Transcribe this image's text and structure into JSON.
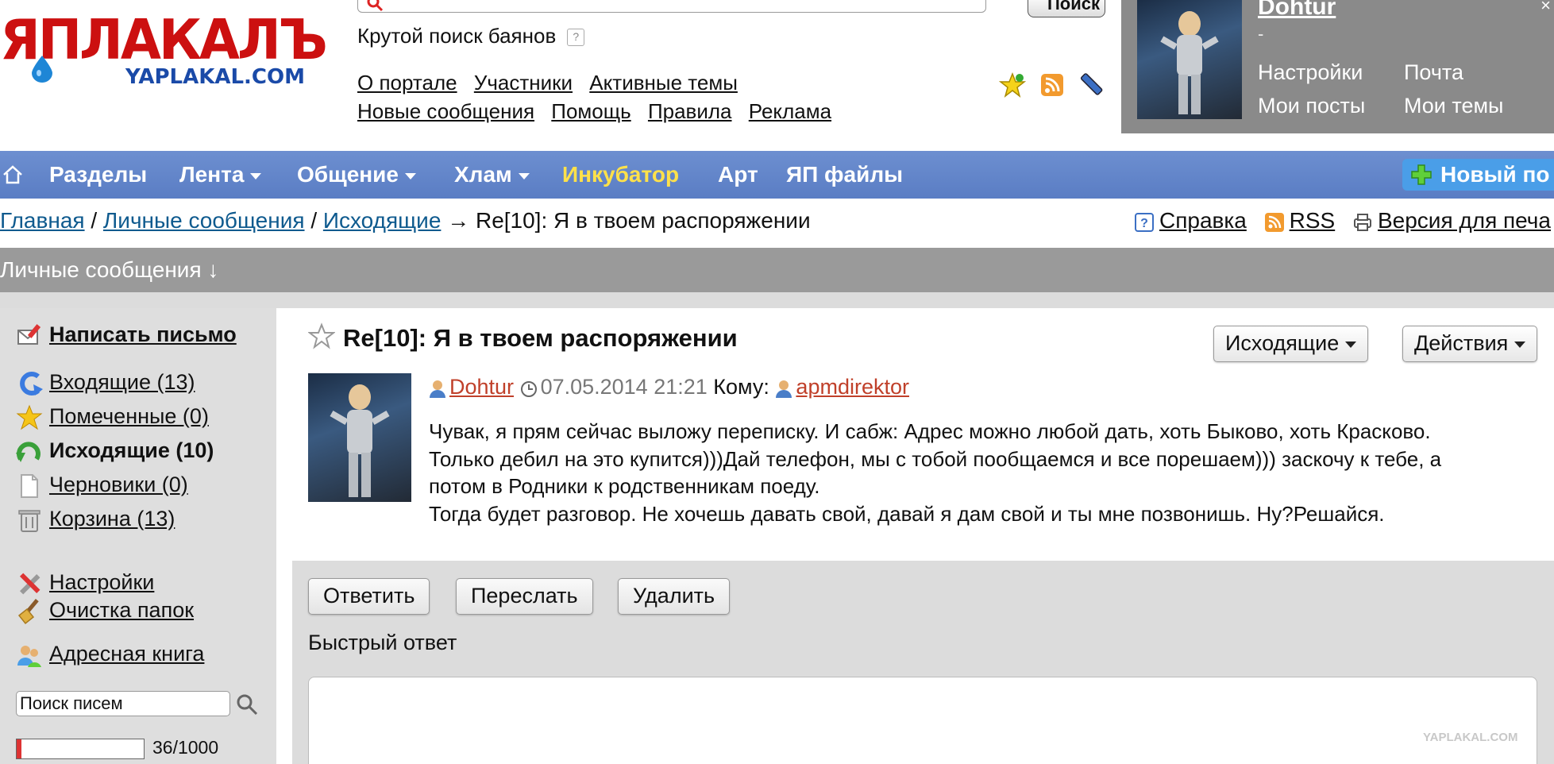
{
  "logo": {
    "main": "ЯПЛАКАЛЪ",
    "sub": "YAPLAKAL.COM"
  },
  "search": {
    "button": "Поиск",
    "tagline": "Крутой поиск баянов",
    "help": "?"
  },
  "top_links": {
    "row1": [
      "О портале",
      "Участники",
      "Активные темы"
    ],
    "row2": [
      "Новые сообщения",
      "Помощь",
      "Правила",
      "Реклама"
    ]
  },
  "user": {
    "name": "Dohtur",
    "status": "-",
    "links": [
      "Настройки",
      "Почта",
      "Мои посты",
      "Мои темы"
    ]
  },
  "nav": {
    "items": [
      {
        "label": "Разделы"
      },
      {
        "label": "Лента"
      },
      {
        "label": "Общение"
      },
      {
        "label": "Хлам"
      },
      {
        "label": "Инкубатор"
      },
      {
        "label": "Арт"
      },
      {
        "label": "ЯП файлы"
      }
    ],
    "new_post": "Новый по"
  },
  "breadcrumb": {
    "items": [
      "Главная",
      "Личные сообщения",
      "Исходящие"
    ],
    "sep": "/",
    "arrow": "→",
    "current": "Re[10]: Я в твоем распоряжении",
    "right": [
      "Справка",
      "RSS",
      "Версия для печа"
    ]
  },
  "section": {
    "title": "Личные сообщения ↓"
  },
  "sidebar": {
    "compose": "Написать письмо",
    "folders": [
      {
        "label": "Входящие (13)"
      },
      {
        "label": "Помеченные (0)"
      },
      {
        "label": "Исходящие (10)"
      },
      {
        "label": "Черновики (0)"
      },
      {
        "label": "Корзина (13)"
      }
    ],
    "settings": "Настройки",
    "cleanup": "Очистка папок",
    "addressbook": "Адресная книга",
    "search_value": "Поиск писем",
    "quota_text": "36/1000",
    "quota_fraction": 0.036
  },
  "message": {
    "title": "Re[10]: Я в твоем распоряжении",
    "folder_button": "Исходящие",
    "actions_button": "Действия",
    "author": "Dohtur",
    "date": "07.05.2014 21:21",
    "to_label": "Кому:",
    "recipient": "apmdirektor",
    "body": [
      "Чувак, я прям сейчас выложу переписку. И сабж: Адрес можно любой дать, хоть Быково, хоть Красково.",
      "Только дебил на это купится)))Дай телефон, мы с тобой пообщаемся и все порешаем))) заскочу к тебе, а",
      "потом в Родники к родственникам поеду.",
      "Тогда будет разговор. Не хочешь давать свой, давай я дам свой и ты мне позвонишь. Ну?Решайся."
    ]
  },
  "actions": {
    "reply": "Ответить",
    "forward": "Переслать",
    "delete": "Удалить"
  },
  "quick_reply": {
    "label": "Быстрый ответ"
  },
  "watermark": "YAPLAKAL.COM",
  "colors": {
    "nav_bg": "#5a7dc4",
    "incubator": "#ffe14a",
    "author": "#c0402a",
    "link": "#0e5a8e"
  }
}
